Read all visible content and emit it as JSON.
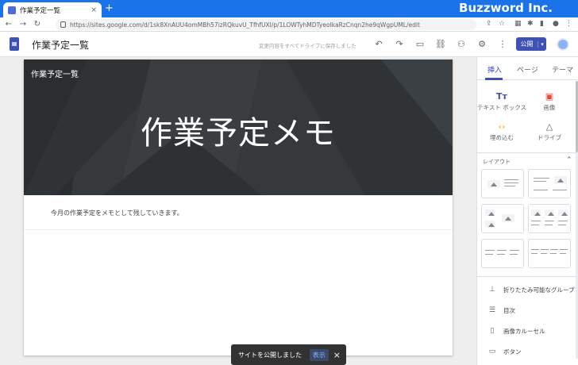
{
  "browser": {
    "tab_title": "作業予定一覧",
    "tab_close": "×",
    "new_tab": "+",
    "url": "https://sites.google.com/d/1sk8XnAUU4omMBh57izRQkuvU_TfhfUXI/p/1LOWTyhMDTyeoIkaRzCnqn2he9qWgpUML/edit",
    "brand": "Buzzword Inc.",
    "nav": {
      "back": "←",
      "forward": "→",
      "reload": "↻"
    }
  },
  "header": {
    "doc_title": "作業予定一覧",
    "saved_status": "変更内容をすべてドライブに保存しました",
    "publish_label": "公開"
  },
  "page": {
    "site_name": "作業予定一覧",
    "hero_title": "作業予定メモ",
    "body_text": "今月の作業予定をメモとして残していきます。"
  },
  "toast": {
    "message": "サイトを公開しました",
    "action": "表示",
    "close": "×"
  },
  "panel": {
    "tabs": [
      {
        "label": "挿入"
      },
      {
        "label": "ページ"
      },
      {
        "label": "テーマ"
      }
    ],
    "insert_items": [
      {
        "icon": "Tт",
        "label": "テキスト ボックス"
      },
      {
        "icon": "▣",
        "label": "画像"
      },
      {
        "icon": "‹›",
        "label": "埋め込む"
      },
      {
        "icon": "△",
        "label": "ドライブ"
      }
    ],
    "layouts_label": "レイアウト",
    "layouts_chevron": "⌃",
    "components": [
      {
        "icon": "⊥",
        "label": "折りたたみ可能なグループ"
      },
      {
        "icon": "☰",
        "label": "目次"
      },
      {
        "icon": "▯",
        "label": "画像カルーセル"
      },
      {
        "icon": "▭",
        "label": "ボタン"
      }
    ]
  },
  "colors": {
    "accent": "#3f51b5",
    "browser_bar": "#1a73e8",
    "banner": "#35393c"
  }
}
